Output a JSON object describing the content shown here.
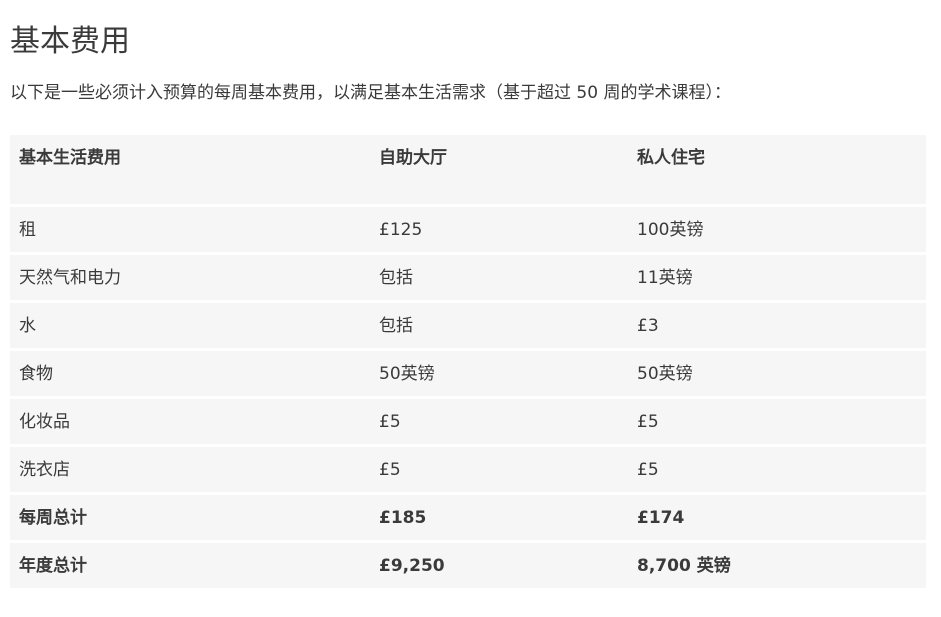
{
  "page": {
    "title": "基本费用",
    "intro": "以下是一些必须计入预算的每周基本费用，以满足基本生活需求（基于超过 50 周的学术课程）："
  },
  "table": {
    "headers": [
      "基本生活费用",
      "自助大厅",
      "私人住宅"
    ],
    "rows": [
      {
        "label": "租",
        "hall": "£125",
        "private": "100英镑",
        "total": false
      },
      {
        "label": "天然气和电力",
        "hall": "包括",
        "private": "11英镑",
        "total": false
      },
      {
        "label": "水",
        "hall": "包括",
        "private": "£3",
        "total": false
      },
      {
        "label": "食物",
        "hall": "50英镑",
        "private": "50英镑",
        "total": false
      },
      {
        "label": "化妆品",
        "hall": "£5",
        "private": "£5",
        "total": false
      },
      {
        "label": "洗衣店",
        "hall": "£5",
        "private": "£5",
        "total": false
      },
      {
        "label": "每周总计",
        "hall": "£185",
        "private": "£174",
        "total": true
      },
      {
        "label": "年度总计",
        "hall": "£9,250",
        "private": "8,700 英镑",
        "total": true
      }
    ]
  }
}
